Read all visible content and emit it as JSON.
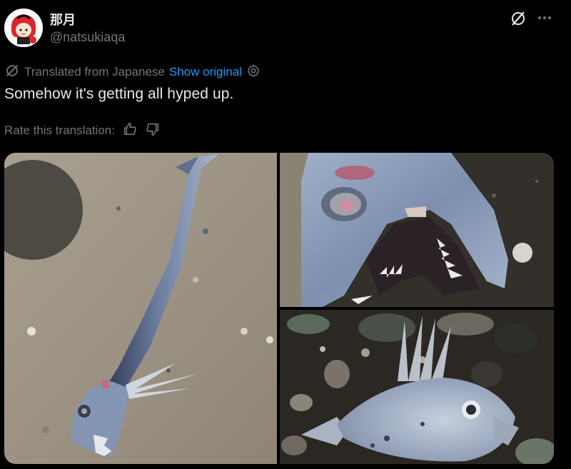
{
  "author": {
    "display_name": "那月",
    "handle": "@natsukiaqa"
  },
  "icons": {
    "grok": "grok-icon",
    "more": "more-icon",
    "translate": "translate-icon",
    "settings": "settings-gear-icon",
    "thumbs_up": "thumbs-up-icon",
    "thumbs_down": "thumbs-down-icon"
  },
  "translation": {
    "label": "Translated from Japanese",
    "show_original": "Show original"
  },
  "tweet": {
    "text": "Somehow it's getting all hyped up."
  },
  "rating": {
    "label": "Rate this translation:"
  },
  "colors": {
    "background": "#000000",
    "text": "#e7e9ea",
    "muted": "#71767b",
    "link": "#1d9bf0",
    "sand": "#a39a8c",
    "dark_sand": "#3a3733",
    "fish": "#8fa0b8"
  },
  "media": {
    "count": 3
  }
}
